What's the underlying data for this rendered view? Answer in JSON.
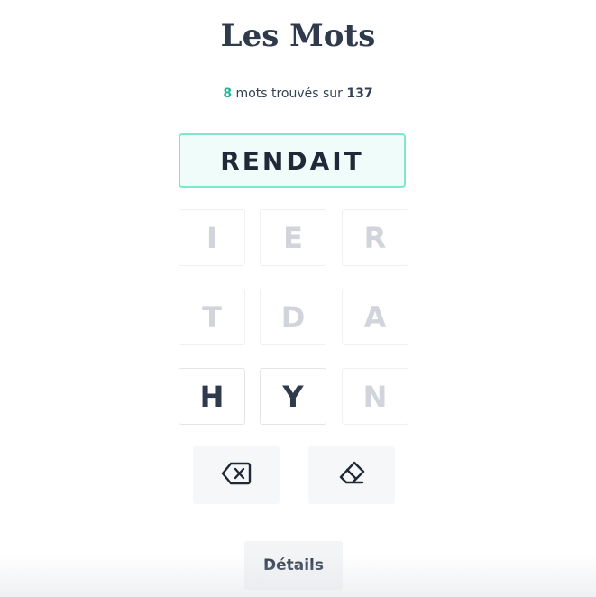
{
  "header": {
    "title": "Les Mots"
  },
  "score": {
    "found": "8",
    "text": " mots trouvés sur ",
    "total": "137"
  },
  "current_word": "RENDAIT",
  "tiles": [
    {
      "letter": "I",
      "state": "used"
    },
    {
      "letter": "E",
      "state": "used"
    },
    {
      "letter": "R",
      "state": "used"
    },
    {
      "letter": "T",
      "state": "used"
    },
    {
      "letter": "D",
      "state": "used"
    },
    {
      "letter": "A",
      "state": "used"
    },
    {
      "letter": "H",
      "state": "available"
    },
    {
      "letter": "Y",
      "state": "available"
    },
    {
      "letter": "N",
      "state": "used"
    }
  ],
  "actions": {
    "backspace_icon": "backspace-icon",
    "clear_icon": "eraser-icon"
  },
  "details_button": {
    "label": "Détails"
  },
  "colors": {
    "accent": "#1fb59a",
    "word_border": "#7ee8cf",
    "word_bg": "#effcf9",
    "text_dark": "#2f3a4c",
    "tile_disabled": "#d1d5db"
  }
}
